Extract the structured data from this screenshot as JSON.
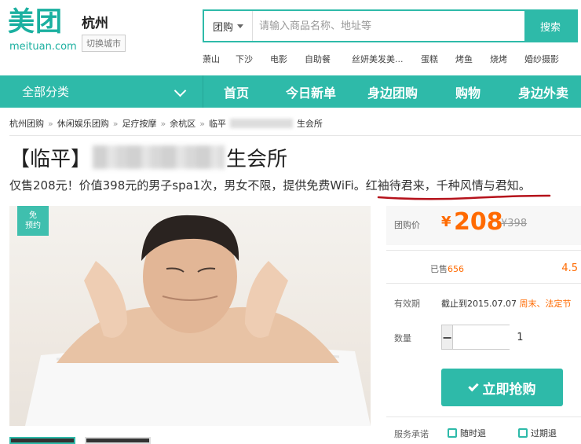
{
  "header": {
    "logo_cn": "美团",
    "logo_en": "meituan.com",
    "city": "杭州",
    "switch_city": "切换城市",
    "search": {
      "type": "团购",
      "placeholder": "请输入商品名称、地址等",
      "button": "搜索"
    },
    "hot_links": [
      "萧山",
      "下沙",
      "电影",
      "自助餐",
      "丝妍美发美...",
      "蛋糕",
      "烤鱼",
      "烧烤",
      "婚纱摄影"
    ]
  },
  "nav": {
    "all_categories": "全部分类",
    "items": [
      "首页",
      "今日新单",
      "身边团购",
      "购物",
      "身边外卖"
    ]
  },
  "breadcrumb": [
    "杭州团购",
    "休闲娱乐团购",
    "足疗按摩",
    "余杭区",
    "临平",
    "生会所"
  ],
  "deal": {
    "title_prefix": "【临平】",
    "title_suffix": "生会所",
    "subtitle_main": "仅售208元！价值398元的男子spa1次，男女不限，提供免费WiFi。",
    "subtitle_highlight": "红袖待君来，千种风情与君知。",
    "badge_line1": "免",
    "badge_line2": "预约"
  },
  "panel": {
    "price_label": "团购价",
    "currency": "¥",
    "price": "208",
    "original_price": "¥398",
    "sold_label": "已售",
    "sold_count": "656",
    "rating": "4.5",
    "valid_label": "有效期",
    "valid_until": "截止到2015.07.07",
    "valid_extra": "周末、法定节",
    "quantity_label": "数量",
    "quantity_minus": "−",
    "quantity_value": "1",
    "quantity_plus": "+",
    "buy_button": "立即抢购",
    "promise_label": "服务承诺",
    "promise_items": [
      "随时退",
      "过期退"
    ]
  },
  "colors": {
    "brand": "#2ebaa9",
    "price": "#ff6a00",
    "underline": "#b5121b"
  }
}
